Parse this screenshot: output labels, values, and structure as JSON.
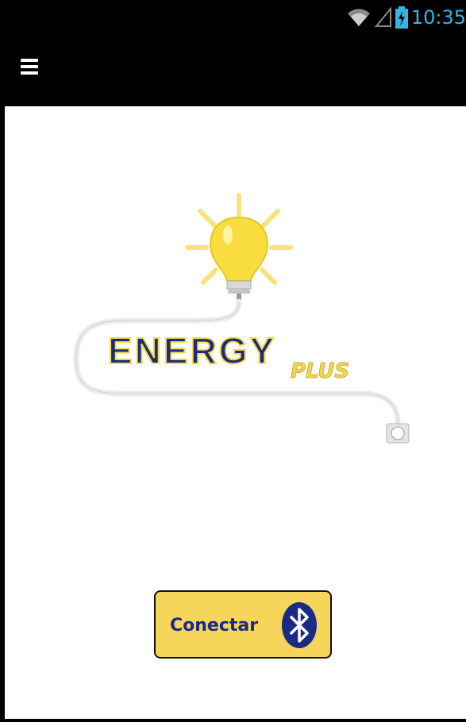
{
  "status_bar": {
    "time": "10:35",
    "icons": [
      "wifi-icon",
      "signal-icon",
      "battery-charging-icon"
    ],
    "time_color": "#33b5e5"
  },
  "action_bar": {
    "menu_icon": "hamburger-menu-icon"
  },
  "logo": {
    "title": "ENERGY",
    "subtitle": "PLUS",
    "bulb_color": "#f9dd3f",
    "title_color": "#1b2a85"
  },
  "connect_button": {
    "label": "Conectar",
    "icon": "bluetooth-icon",
    "background": "#f6d65a"
  }
}
